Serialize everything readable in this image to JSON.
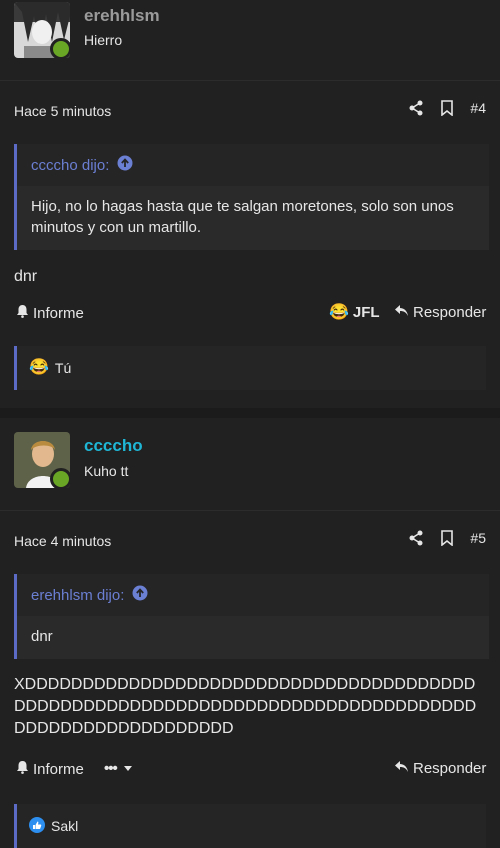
{
  "posts": [
    {
      "username": "erehhlsm",
      "username_color": "#9a9a9a",
      "user_title": "Hierro",
      "time": "Hace 5 minutos",
      "post_number": "#4",
      "quote_author": "ccccho dijo:",
      "quote_text": "Hijo, no lo hagas hasta que te salgan moretones, solo son unos minutos y con un martillo.",
      "body": "dnr",
      "report_label": "Informe",
      "reaction_label": "JFL",
      "reply_label": "Responder",
      "reactions_summary": "Tú"
    },
    {
      "username": "ccccho",
      "username_color": "#1fb6d6",
      "user_title": "Kuho tt",
      "time": "Hace 4 minutos",
      "post_number": "#5",
      "quote_author": "erehhlsm dijo:",
      "quote_text": "dnr",
      "body": "XDDDDDDDDDDDDDDDDDDDDDDDDDDDDDDDDDDDDDDDDDDDDDDDDDDDDDDDDDDDDDDDDDDDDDDDDDDDDDDDDDDDDDDDDDDDDDDDDDD",
      "report_label": "Informe",
      "more_label": "•••",
      "reply_label": "Responder",
      "reactions_summary": "Sakl"
    }
  ],
  "colors": {
    "accent_quote": "#5b6bc6",
    "online": "#6aa625"
  },
  "icons": [
    "share-icon",
    "bookmark-icon",
    "bell-icon",
    "reply-icon",
    "arrow-up-circle-icon",
    "laughing-emoji",
    "like-emoji",
    "caret-down-icon"
  ]
}
